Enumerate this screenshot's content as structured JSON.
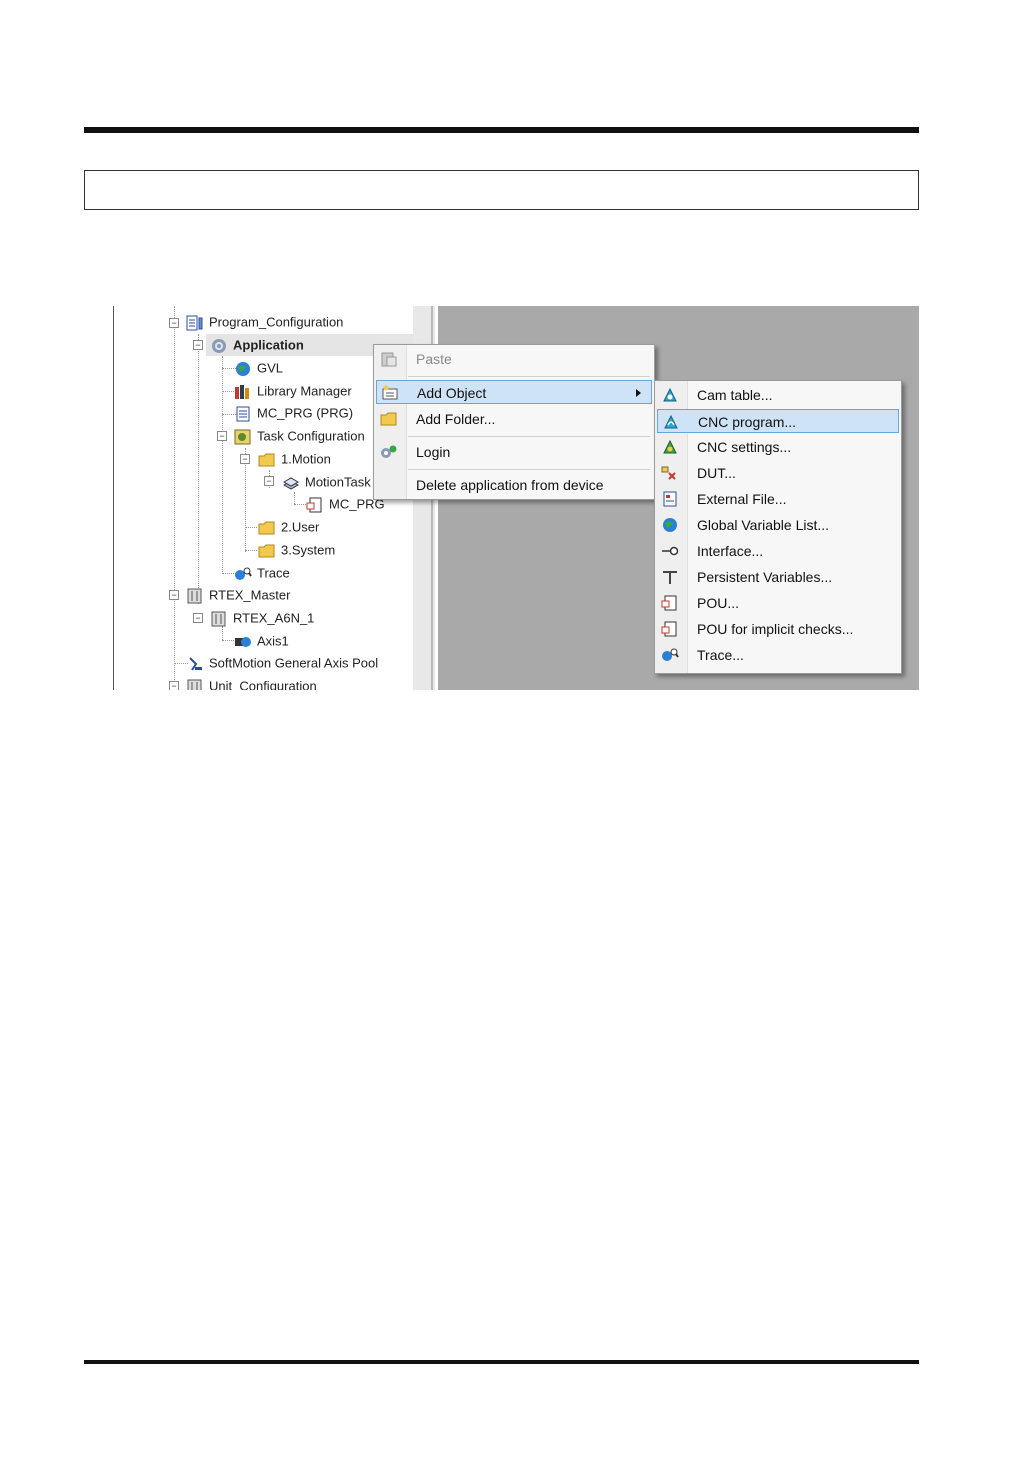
{
  "page": {
    "accent": "#cfe3f7"
  },
  "tree": {
    "items": [
      {
        "label": "Program_Configuration",
        "icon": "program-config-icon"
      },
      {
        "label": "Application",
        "icon": "application-gear-icon"
      },
      {
        "label": "GVL",
        "icon": "globe-icon"
      },
      {
        "label": "Library Manager",
        "icon": "library-books-icon"
      },
      {
        "label": "MC_PRG (PRG)",
        "icon": "document-icon"
      },
      {
        "label": "Task Configuration",
        "icon": "task-config-icon"
      },
      {
        "label": "1.Motion",
        "icon": "folder-icon"
      },
      {
        "label": "MotionTask",
        "icon": "task-stack-icon"
      },
      {
        "label": "MC_PRG",
        "icon": "pou-icon"
      },
      {
        "label": "2.User",
        "icon": "folder-icon"
      },
      {
        "label": "3.System",
        "icon": "folder-icon"
      },
      {
        "label": "Trace",
        "icon": "trace-icon"
      },
      {
        "label": "RTEX_Master",
        "icon": "device-icon"
      },
      {
        "label": "RTEX_A6N_1",
        "icon": "device-icon"
      },
      {
        "label": "Axis1",
        "icon": "axis-icon"
      },
      {
        "label": "SoftMotion General Axis Pool",
        "icon": "axis-pool-icon"
      },
      {
        "label": "Unit_Configuration",
        "icon": "device-icon"
      }
    ]
  },
  "context_menu": {
    "items": [
      {
        "label": "Paste",
        "icon": "paste-icon",
        "disabled": true
      },
      {
        "label": "Add Object",
        "icon": "add-object-icon",
        "submenu": true
      },
      {
        "label": "Add Folder...",
        "icon": "folder-icon"
      },
      {
        "label": "Login",
        "icon": "login-icon"
      },
      {
        "label": "Delete application from device",
        "icon": ""
      }
    ]
  },
  "submenu": {
    "items": [
      {
        "label": "Cam table...",
        "icon": "cam-table-icon"
      },
      {
        "label": "CNC program...",
        "icon": "cnc-program-icon"
      },
      {
        "label": "CNC settings...",
        "icon": "cnc-settings-icon"
      },
      {
        "label": "DUT...",
        "icon": "dut-icon"
      },
      {
        "label": "External File...",
        "icon": "external-file-icon"
      },
      {
        "label": "Global Variable List...",
        "icon": "globe-icon"
      },
      {
        "label": "Interface...",
        "icon": "interface-icon"
      },
      {
        "label": "Persistent Variables...",
        "icon": "persistent-vars-icon"
      },
      {
        "label": "POU...",
        "icon": "pou-icon"
      },
      {
        "label": "POU for implicit checks...",
        "icon": "pou-icon"
      },
      {
        "label": "Trace...",
        "icon": "trace-icon"
      }
    ]
  }
}
